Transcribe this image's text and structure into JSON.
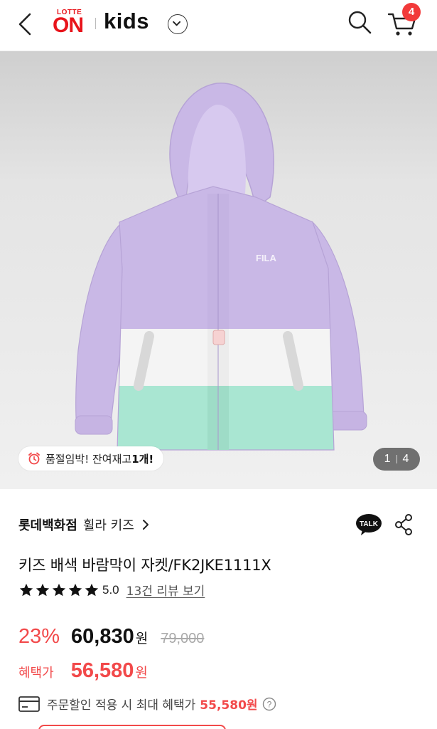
{
  "header": {
    "logo_small": "LOTTE",
    "logo_big": "ON",
    "section": "kids",
    "cart_count": "4"
  },
  "product_image": {
    "garment_logo": "FILA",
    "stock_text": "품절임박! 잔여재고 ",
    "stock_count": "1개!",
    "image_index": "1",
    "image_total": "4"
  },
  "product": {
    "store": "롯데백화점",
    "brand": "휠라 키즈",
    "title": "키즈 배색 바람막이 자켓/FK2JKE1111X",
    "talk_label": "TALK",
    "rating": "5.0",
    "rating_stars": 5,
    "review_link": "13건 리뷰 보기",
    "discount": "23%",
    "price": "60,830",
    "currency": "원",
    "original_price": "79,000",
    "benefit_label": "혜택가",
    "benefit_price": "56,580",
    "order_text": "주문할인 적용 시 최대 혜택가",
    "order_price": "55,580원"
  },
  "colors": {
    "accent": "#f2494a",
    "brand_red": "#e8141b",
    "jacket_lavender": "#c9b8e6",
    "jacket_white": "#f4f4f4",
    "jacket_mint": "#a9e6d2"
  },
  "icons": [
    "back-arrow-icon",
    "chevron-down-icon",
    "search-icon",
    "cart-icon",
    "alarm-clock-icon",
    "chevron-right-icon",
    "kakao-talk-icon",
    "share-icon",
    "star-icon",
    "card-icon",
    "help-icon"
  ]
}
